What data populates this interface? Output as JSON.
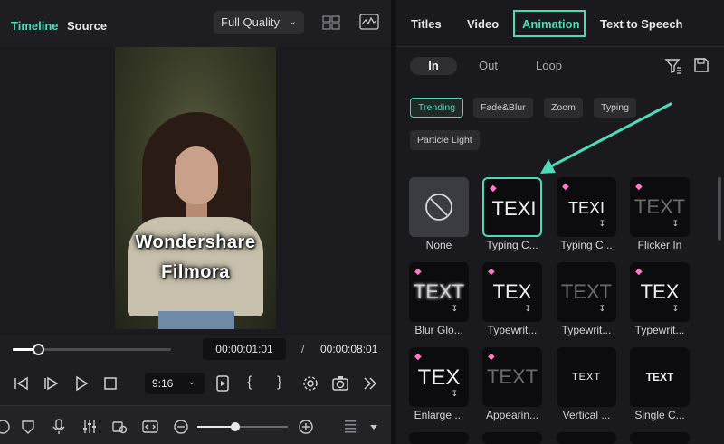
{
  "left": {
    "tabs": {
      "timeline": "Timeline",
      "source": "Source"
    },
    "quality": {
      "value": "Full Quality"
    },
    "caption": {
      "line1": "Wondershare",
      "line2": "Filmora"
    },
    "playback": {
      "progress": 0.16,
      "current_time": "00:00:01:01",
      "separator": "/",
      "total_time": "00:00:08:01"
    },
    "controls": {
      "ratio": "9:16",
      "brace_open": "{",
      "brace_close": "}"
    },
    "zoom": {
      "level": 0.42
    }
  },
  "right": {
    "tabs": {
      "titles": "Titles",
      "video": "Video",
      "animation": "Animation",
      "tts": "Text to Speech"
    },
    "segments": {
      "in": "In",
      "out": "Out",
      "loop": "Loop"
    },
    "chips": [
      "Trending",
      "Fade&Blur",
      "Zoom",
      "Typing",
      "Particle Light"
    ],
    "cards": [
      {
        "label": "None",
        "text": ""
      },
      {
        "label": "Typing C...",
        "text": "TEXI"
      },
      {
        "label": "Typing C...",
        "text": "TEXI"
      },
      {
        "label": "Flicker In",
        "text": "TEXT"
      },
      {
        "label": "Blur Glo...",
        "text": "TEXT"
      },
      {
        "label": "Typewrit...",
        "text": "TEX"
      },
      {
        "label": "Typewrit...",
        "text": "TEXT"
      },
      {
        "label": "Typewrit...",
        "text": "TEX"
      },
      {
        "label": "Enlarge ...",
        "text": "TEX"
      },
      {
        "label": "Appearin...",
        "text": "TEXT"
      },
      {
        "label": "Vertical ...",
        "text": "TEXT"
      },
      {
        "label": "Single C...",
        "text": "TEXT"
      }
    ],
    "accent": "#4fd9b8",
    "premium_icon": "gem-icon",
    "download_icon": "download-icon"
  }
}
